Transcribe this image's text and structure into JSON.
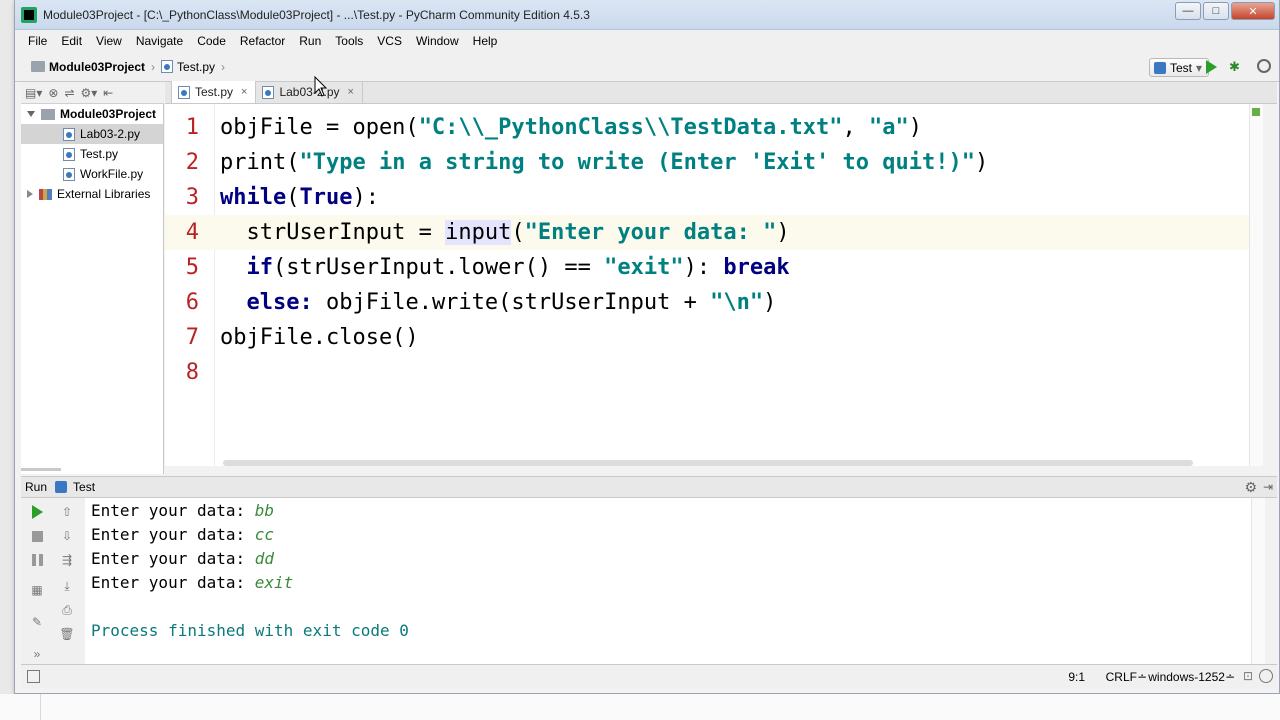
{
  "window": {
    "title": "Module03Project - [C:\\_PythonClass\\Module03Project] - ...\\Test.py - PyCharm Community Edition 4.5.3",
    "minimize": "—",
    "maximize": "□",
    "close": "✕"
  },
  "menu": [
    "File",
    "Edit",
    "View",
    "Navigate",
    "Code",
    "Refactor",
    "Run",
    "Tools",
    "VCS",
    "Window",
    "Help"
  ],
  "breadcrumb": {
    "project": "Module03Project",
    "file": "Test.py"
  },
  "run_config": {
    "label": "Test",
    "arrow": "▾"
  },
  "project_tree": {
    "root": "Module03Project",
    "files": [
      "Lab03-2.py",
      "Test.py",
      "WorkFile.py"
    ],
    "libraries": "External Libraries"
  },
  "tabs": [
    {
      "label": "Test.py",
      "close": "×"
    },
    {
      "label": "Lab03-2.py",
      "close": "×"
    }
  ],
  "code": {
    "line_numbers": [
      "1",
      "2",
      "3",
      "4",
      "5",
      "6",
      "7",
      "8"
    ],
    "l1_a": "objFile = open(",
    "l1_b": "\"C:\\\\_PythonClass\\\\TestData.txt\"",
    "l1_c": ", ",
    "l1_d": "\"a\"",
    "l1_e": ")",
    "l2_a": "print(",
    "l2_b": "\"Type in a string to write (Enter 'Exit' to quit!)\"",
    "l2_c": ")",
    "l3_a": "while",
    "l3_b": "(",
    "l3_c": "True",
    "l3_d": "):",
    "l4_a": "  strUserInput = ",
    "l4_b": "input",
    "l4_c": "(",
    "l4_d": "\"Enter your data: \"",
    "l4_e": ")",
    "l5_a": "  ",
    "l5_b": "if",
    "l5_c": "(strUserInput.lower() == ",
    "l5_d": "\"exit\"",
    "l5_e": "): ",
    "l5_f": "break",
    "l6_a": "  ",
    "l6_b": "else:",
    "l6_c": " objFile.write(strUserInput + ",
    "l6_d": "\"\\n\"",
    "l6_e": ")",
    "l7_a": "objFile.close()"
  },
  "run_panel": {
    "title": "Run",
    "config": "Test",
    "gear": "⚙",
    "pin": "⇥"
  },
  "console": {
    "lines": [
      {
        "prompt": "Enter your data: ",
        "input": "bb"
      },
      {
        "prompt": "Enter your data: ",
        "input": "cc"
      },
      {
        "prompt": "Enter your data: ",
        "input": "dd"
      },
      {
        "prompt": "Enter your data: ",
        "input": "exit"
      }
    ],
    "exit_message": "Process finished with exit code 0"
  },
  "status": {
    "position": "9:1",
    "line_separator": "CRLF∸",
    "encoding": "windows-1252∸"
  },
  "colors": {
    "keyword": "#000080",
    "string": "#008080",
    "line_number": "#b22222",
    "console_input": "#3a8a3a",
    "run_green": "#2aa02a"
  }
}
